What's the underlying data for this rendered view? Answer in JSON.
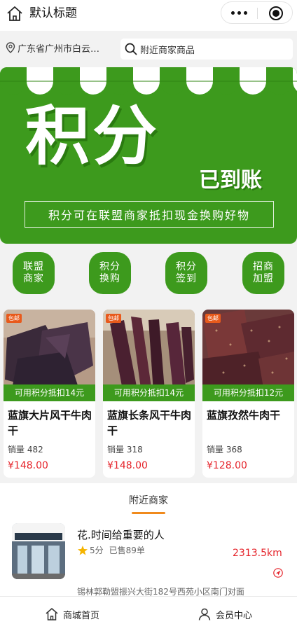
{
  "nav": {
    "title": "默认标题"
  },
  "location": {
    "text": "广东省广州市白云…"
  },
  "search": {
    "placeholder": "附近商家商品"
  },
  "banner": {
    "headline": "积分",
    "subline": "已到账",
    "slogan": "积分可在联盟商家抵扣现金换购好物",
    "bg_color": "#3d9a1d"
  },
  "quick_nav": [
    {
      "label": "联盟商家"
    },
    {
      "label": "积分换购"
    },
    {
      "label": "积分签到"
    },
    {
      "label": "招商加盟"
    }
  ],
  "products": [
    {
      "badge": "包邮",
      "discount": "可用积分抵扣14元",
      "name": "蓝旗大片风干牛肉干",
      "sales": "销量 482",
      "price": "¥148.00"
    },
    {
      "badge": "包邮",
      "discount": "可用积分抵扣14元",
      "name": "蓝旗长条风干牛肉干",
      "sales": "销量 318",
      "price": "¥148.00"
    },
    {
      "badge": "包邮",
      "discount": "可用积分抵扣12元",
      "name": "蓝旗孜然牛肉干",
      "sales": "销量 368",
      "price": "¥128.00"
    }
  ],
  "nearby": {
    "title": "附近商家",
    "shop": {
      "name": "花.时间给重要的人",
      "rating": "5分",
      "sold": "已售89单",
      "distance": "2313.5km",
      "address": "锡林郭勒盟振兴大街182号西苑小区南门对面"
    }
  },
  "tabbar": [
    {
      "label": "商城首页",
      "icon": "home-icon"
    },
    {
      "label": "会员中心",
      "icon": "user-icon"
    }
  ],
  "colors": {
    "accent_green": "#3d9a1d",
    "price_red": "#e5232a",
    "tab_orange": "#f08a1c"
  }
}
